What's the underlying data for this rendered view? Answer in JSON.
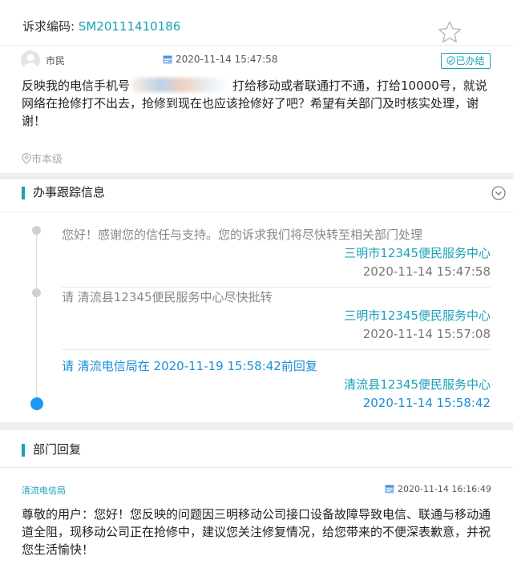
{
  "appeal": {
    "code_label": "诉求编码:",
    "code_value": "SM20111410186",
    "submitter": "市民",
    "submit_time": "2020-11-14 15:47:58",
    "status": "已办结",
    "content_before": "反映我的电信手机号",
    "content_after": "打给移动或者联通打不通，打给10000号，就说网络在抢修打不出去，抢修到现在也应该抢修好了吧？希望有关部门及时核实处理，谢谢！",
    "location": "市本级"
  },
  "tracking": {
    "title": "办事跟踪信息",
    "items": [
      {
        "text": "您好！感谢您的信任与支持。您的诉求我们将尽快转至相关部门处理",
        "org": "三明市12345便民服务中心",
        "time": "2020-11-14 15:47:58"
      },
      {
        "text": "请 清流县12345便民服务中心尽快批转",
        "org": "三明市12345便民服务中心",
        "time": "2020-11-14 15:57:08"
      },
      {
        "text": "请 清流电信局在 2020-11-19 15:58:42前回复",
        "org": "清流县12345便民服务中心",
        "time": "2020-11-14 15:58:42"
      }
    ]
  },
  "reply": {
    "title": "部门回复",
    "department": "清流电信局",
    "time": "2020-11-14 16:16:49",
    "content": "尊敬的用户：您好！您反映的问题因三明移动公司接口设备故障导致电信、联通与移动通道全阻，现移动公司正在抢修中，建议您关注修复情况，给您带来的不便深表歉意，并祝您生活愉快！"
  },
  "colors": {
    "accent": "#1aa0b8",
    "active": "#1b99f2"
  },
  "icons": [
    "star-icon",
    "avatar-icon",
    "calendar-icon",
    "check-circle-icon",
    "location-pin-icon",
    "chevron-down-icon"
  ]
}
